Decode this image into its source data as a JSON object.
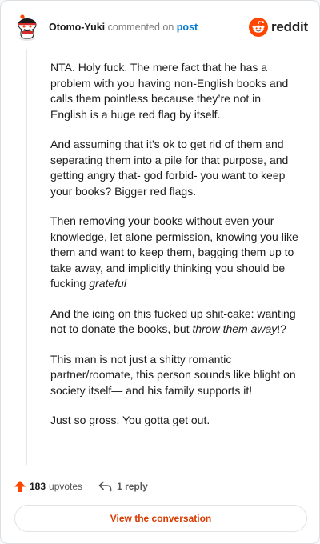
{
  "header": {
    "username": "Otomo-Yuki",
    "verb": " commented on ",
    "post_link": "post",
    "logo_text": "reddit",
    "accent_color": "#ff4500"
  },
  "comment": {
    "paragraphs": [
      [
        {
          "t": "NTA. Holy fuck. The mere fact that he has a problem with you having non-English books and calls them pointless because they’re not in English is a huge red flag by itself."
        }
      ],
      [
        {
          "t": "And assuming that it’s ok to get rid of them and seperating them into a pile for that purpose, and getting angry that- god forbid- you want to keep your books? Bigger red flags."
        }
      ],
      [
        {
          "t": "Then removing your books without even your knowledge, let alone permission, knowing you like them and want to keep them, bagging them up to take away, and implicitly thinking you should be fucking "
        },
        {
          "t": "grateful",
          "i": true
        }
      ],
      [
        {
          "t": "And the icing on this fucked up shit-cake: wanting not to donate the books, but "
        },
        {
          "t": "throw them away",
          "i": true
        },
        {
          "t": "!?"
        }
      ],
      [
        {
          "t": "This man is not just a shitty romantic partner/roomate, this person sounds like blight on society itself— and his family supports it!"
        }
      ],
      [
        {
          "t": "Just so gross. You gotta get out."
        }
      ]
    ]
  },
  "footer": {
    "upvote_count": "183",
    "upvote_label": "upvotes",
    "reply_label": "1 reply",
    "upvote_color": "#ff4500"
  },
  "actions": {
    "view_conversation": "View the conversation"
  }
}
